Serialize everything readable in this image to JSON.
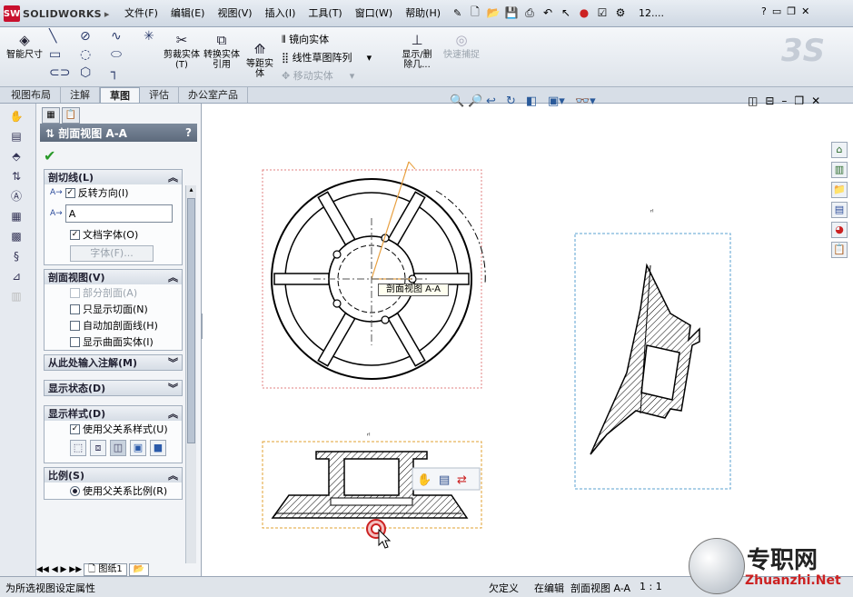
{
  "app": {
    "logo_badge": "SW",
    "name": "SOLIDWORKS"
  },
  "menu": [
    "文件(F)",
    "编辑(E)",
    "视图(V)",
    "插入(I)",
    "工具(T)",
    "窗口(W)",
    "帮助(H)"
  ],
  "quickaccess": {
    "zoom_text": "12....",
    "help": "?"
  },
  "ribbon": {
    "smart_dim": "智能尺寸",
    "trim": "剪裁实体(T)",
    "convert": "转换实体引用",
    "offset": "等距实体",
    "mirror": "镜向实体",
    "linear_pattern": "线性草图阵列",
    "move": "移动实体",
    "show_delete": "显示/删除几...",
    "quick_snap": "快速捕捉"
  },
  "tabs": [
    "视图布局",
    "注解",
    "草图",
    "评估",
    "办公室产品"
  ],
  "active_tab": "草图",
  "panel": {
    "title": "剖面视图 A-A",
    "help": "?",
    "sections": {
      "cutting_line": {
        "title": "剖切线(L)",
        "flip": "反转方向(I)",
        "label_value": "A",
        "doc_font": "文档字体(O)",
        "font_btn": "字体(F)..."
      },
      "section_view": {
        "title": "剖面视图(V)",
        "partial": "部分剖面(A)",
        "slice_only": "只显示切面(N)",
        "auto_hatch": "自动加剖面线(H)",
        "surface": "显示曲面实体(I)"
      },
      "import": {
        "title": "从此处输入注解(M)"
      },
      "display_state": {
        "title": "显示状态(D)"
      },
      "display_style": {
        "title": "显示样式(D)",
        "use_parent": "使用父关系样式(U)"
      },
      "scale": {
        "title": "比例(S)",
        "use_parent_scale": "使用父关系比例(R)"
      }
    }
  },
  "canvas": {
    "tooltip": "剖面视图 A-A"
  },
  "sheet_tab": "图纸1",
  "status": {
    "left": "为所选视图设定属性",
    "undefined": "欠定义",
    "editing": "在编辑",
    "view": "剖面视图 A-A",
    "scale": "1 : 1"
  },
  "watermark": {
    "cn": "专职网",
    "url": "Zhuanzhi.Net"
  }
}
